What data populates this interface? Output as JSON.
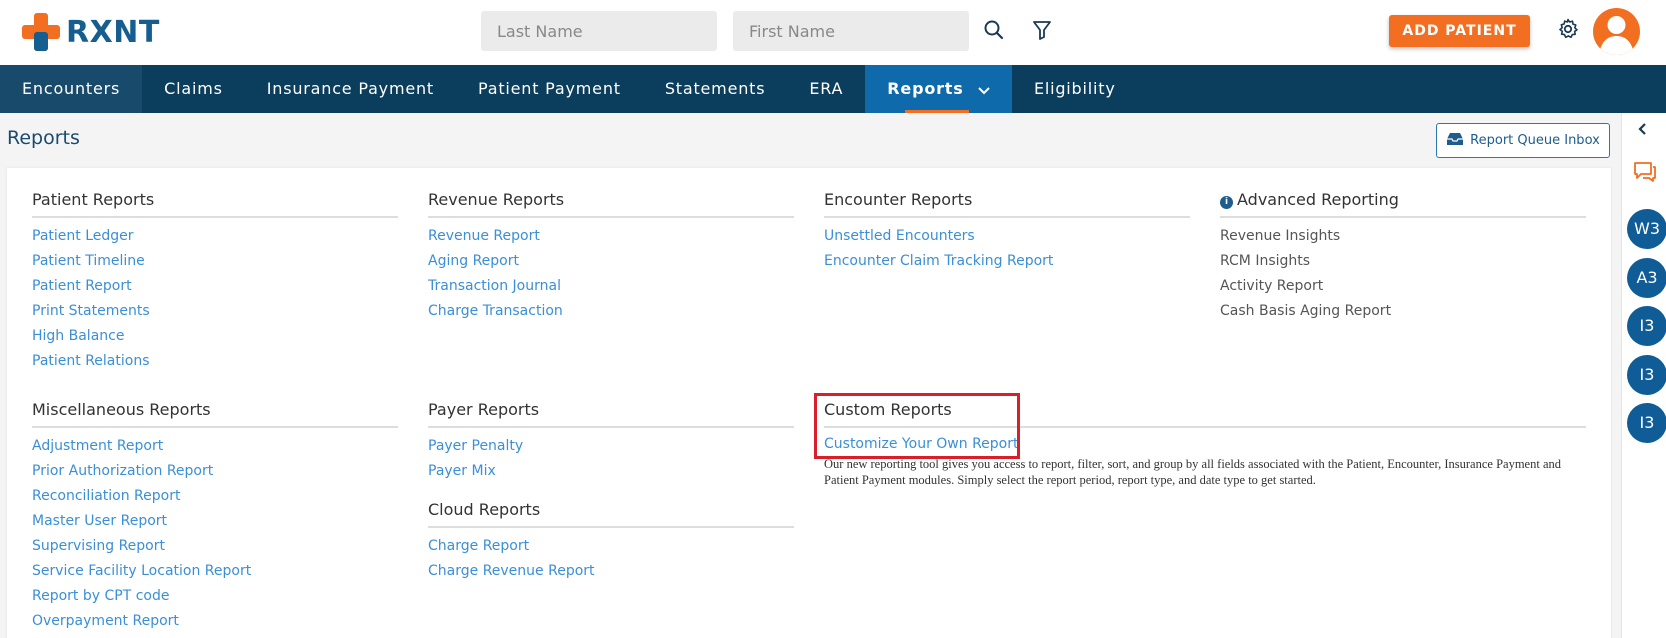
{
  "header": {
    "logo_text": "RXNT",
    "last_name_placeholder": "Last Name",
    "first_name_placeholder": "First Name",
    "add_patient_label": "ADD PATIENT"
  },
  "nav": {
    "items": [
      "Encounters",
      "Claims",
      "Insurance Payment",
      "Patient Payment",
      "Statements",
      "ERA",
      "Reports",
      "Eligibility"
    ],
    "active": "Reports"
  },
  "page": {
    "title": "Reports",
    "queue_button": "Report Queue Inbox"
  },
  "sections": {
    "patient": {
      "title": "Patient Reports",
      "links": [
        "Patient Ledger",
        "Patient Timeline",
        "Patient Report",
        "Print Statements",
        "High Balance",
        "Patient Relations"
      ]
    },
    "revenue": {
      "title": "Revenue Reports",
      "links": [
        "Revenue Report",
        "Aging Report",
        "Transaction Journal",
        "Charge Transaction"
      ]
    },
    "encounter": {
      "title": "Encounter Reports",
      "links": [
        "Unsettled Encounters",
        "Encounter Claim Tracking Report"
      ]
    },
    "advanced": {
      "title": "Advanced Reporting",
      "links": [
        "Revenue Insights",
        "RCM Insights",
        "Activity Report",
        "Cash Basis Aging Report"
      ]
    },
    "misc": {
      "title": "Miscellaneous Reports",
      "links": [
        "Adjustment Report",
        "Prior Authorization Report",
        "Reconciliation Report",
        "Master User Report",
        "Supervising Report",
        "Service Facility Location Report",
        "Report by CPT code",
        "Overpayment Report"
      ]
    },
    "payer": {
      "title": "Payer Reports",
      "links": [
        "Payer Penalty",
        "Payer Mix"
      ]
    },
    "cloud": {
      "title": "Cloud Reports",
      "links": [
        "Charge Report",
        "Charge Revenue Report"
      ]
    },
    "custom": {
      "title": "Custom Reports",
      "links": [
        "Customize Your Own Report"
      ],
      "description": "Our new reporting tool gives you access to report, filter, sort, and group by all fields associated with the Patient, Encounter, Insurance Payment and Patient Payment modules. Simply select the report period, report type, and date type to get started."
    }
  },
  "rail": {
    "badges": [
      "W3",
      "A3",
      "I3",
      "I3",
      "I3"
    ]
  },
  "colors": {
    "navy": "#0b3d5c",
    "active_tab": "#0f6aab",
    "accent": "#f26f21",
    "link": "#3a8fd6",
    "highlight": "#d9202a"
  }
}
